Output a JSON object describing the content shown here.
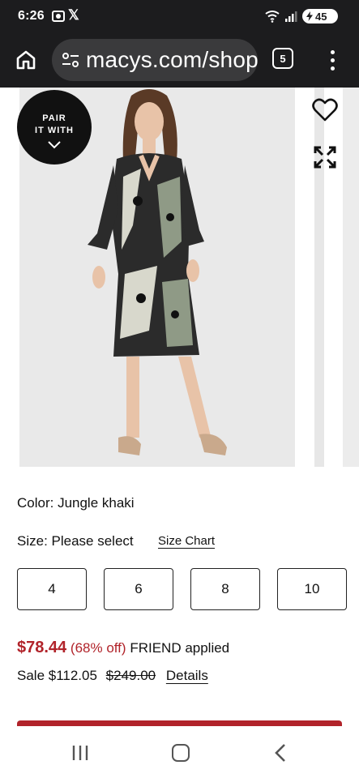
{
  "status_bar": {
    "time": "6:26",
    "battery": "45",
    "icons": [
      "screenshot-icon",
      "x-logo-icon",
      "wifi-icon",
      "signal-icon",
      "battery-charging-icon"
    ]
  },
  "browser": {
    "url": "macys.com/shop",
    "tab_count": "5",
    "icons": [
      "home-icon",
      "tune-icon",
      "tabs-icon",
      "more-vert-icon"
    ]
  },
  "gallery": {
    "pair_with_label": "PAIR\nIT WITH",
    "icons": [
      "chevron-down-icon",
      "heart-icon",
      "expand-icon"
    ],
    "image_colors": {
      "dress_dark": "#1f1f1f",
      "dress_light": "#d8d8cc",
      "dress_khaki": "#8f9a86",
      "skin": "#e8c3a8",
      "hair": "#5a3a26",
      "background": "#e9e9e9"
    }
  },
  "product": {
    "color_line": "Color: Jungle khaki",
    "size_line": "Size: Please select",
    "size_chart_label": "Size Chart",
    "sizes": [
      "4",
      "6",
      "8",
      "10"
    ],
    "price_now": "$78.44",
    "price_discount": "(68% off)",
    "price_promo": "FRIEND applied",
    "sale_price": "Sale $112.05",
    "original_price": "$249.00",
    "details_label": "Details"
  },
  "nav_bar": {
    "icons": [
      "recent-apps-icon",
      "home-circle-icon",
      "back-icon"
    ]
  },
  "colors": {
    "accent_red": "#b1232a",
    "dark_chrome": "#1c1c1e",
    "url_pill": "#3a3a3c"
  }
}
